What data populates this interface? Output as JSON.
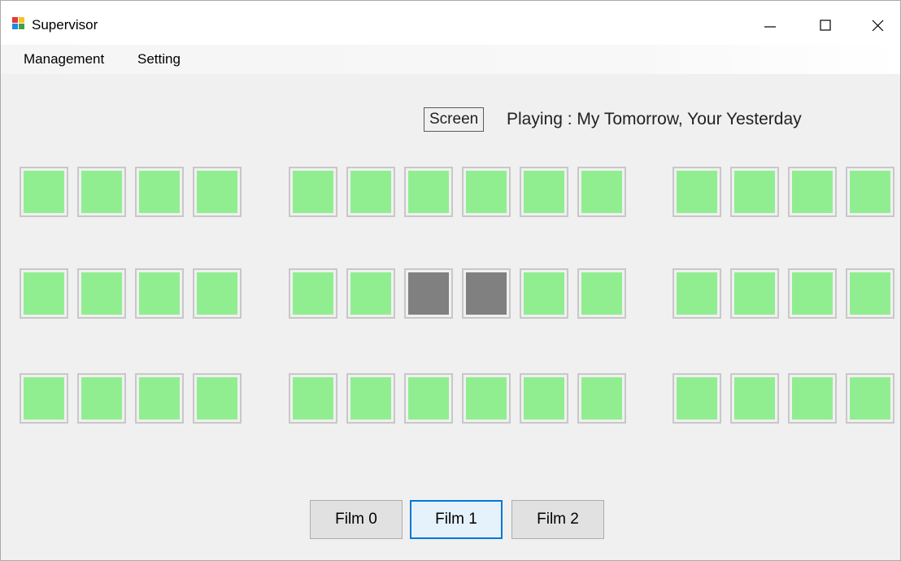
{
  "window": {
    "title": "Supervisor",
    "icon": "app-window-icon",
    "controls": [
      "minimize-icon",
      "maximize-icon",
      "close-icon"
    ]
  },
  "menu": {
    "items": [
      {
        "label": "Management"
      },
      {
        "label": "Setting"
      }
    ]
  },
  "screen": {
    "label": "Screen",
    "playing_text": "Playing : My Tomorrow, Your Yesterday"
  },
  "seating": {
    "colors": {
      "available": "#90ee90",
      "occupied": "#808080",
      "border": "#c8c8c8"
    },
    "rows": [
      {
        "sections": [
          [
            "available",
            "available",
            "available",
            "available"
          ],
          [
            "available",
            "available",
            "available",
            "available",
            "available",
            "available"
          ],
          [
            "available",
            "available",
            "available",
            "available"
          ]
        ]
      },
      {
        "sections": [
          [
            "available",
            "available",
            "available",
            "available"
          ],
          [
            "available",
            "available",
            "occupied",
            "occupied",
            "available",
            "available"
          ],
          [
            "available",
            "available",
            "available",
            "available"
          ]
        ]
      },
      {
        "sections": [
          [
            "available",
            "available",
            "available",
            "available"
          ],
          [
            "available",
            "available",
            "available",
            "available",
            "available",
            "available"
          ],
          [
            "available",
            "available",
            "available",
            "available"
          ]
        ]
      }
    ]
  },
  "films": {
    "buttons": [
      {
        "label": "Film 0"
      },
      {
        "label": "Film 1",
        "focused": true
      },
      {
        "label": "Film 2"
      }
    ]
  }
}
